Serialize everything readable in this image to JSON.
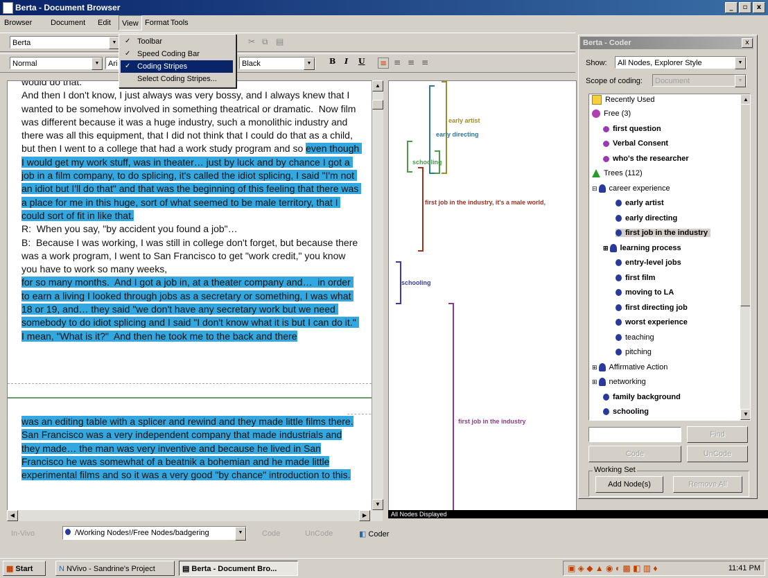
{
  "window": {
    "title": "Berta - Document Browser",
    "min": "_",
    "max": "▫",
    "close": "x"
  },
  "menubar": [
    "Browser",
    "Document",
    "Edit",
    "View",
    "Format",
    "Tools"
  ],
  "toolbar1": {
    "doc_name": "Berta"
  },
  "toolbar2": {
    "style": "Normal",
    "font": "Ari",
    "color": "Black",
    "bold": "B",
    "italic": "I",
    "underline": "U"
  },
  "view_menu": {
    "items": [
      {
        "label": "Toolbar",
        "checked": "✓"
      },
      {
        "label": "Speed Coding Bar",
        "checked": "✓"
      },
      {
        "label": "Coding Stripes",
        "checked": "✓"
      },
      {
        "label": "Select Coding Stripes...",
        "checked": ""
      }
    ]
  },
  "document": {
    "p1_plain": "would do that.\nAnd then I don't know, I just always was very bossy, and I always knew that I wanted to be somehow involved in something theatrical or dramatic.  Now film was different because it was a huge industry, such a monolithic industry and there was all this equipment, that I did not think that I could do that as a child, but then I went to a college that had a work study program and so",
    "p1_hl": "even though I would get my work stuff, was in theater… just by luck and by chance I got a job in a film company, to do splicing, it's called the idiot splicing, I said \"I'm not an idiot but I'll do that\" and that was the beginning of this feeling that there was a place for me in this huge, sort of what seemed to be male territory, that I could sort of fit in like that.",
    "p2_plain": "R:  When you say, \"by accident you found a job\"…\nB:  Because I was working, I was still in college don't forget, but because there was a work program, I went to San Francisco to get \"work credit,\" you know you have to work so many weeks,",
    "p2_hl": "for so many months.  And I got a job in, at a theater company and…  in order to earn a living I looked through jobs as a secretary or something, I was what 18 or 19, and… they said \"we don't have any secretary work but we need somebody to do idiot splicing and I said \"I don't know what it is but I can do it.\" I mean, \"What is it?\"  And then he took me to the back and there",
    "p3_hl": "was an editing table with a splicer and rewind and they made little films there.  San Francisco was a very independent company that made industrials and they made…  the man was very inventive and because he lived in San Francisco he was somewhat of a beatnik a bohemian and he made little experimental films and so it was a very good \"by chance\" introduction to this."
  },
  "stripes": {
    "early_artist": "early artist",
    "early_directing": "early directing",
    "schooling1": "schooling",
    "first_job_male": "first job in the industry, it's a male world,",
    "schooling2": "schooling",
    "first_job": "first job in the industry",
    "status": "All Nodes Displayed"
  },
  "colors": {
    "highlight": "#33a8e0",
    "artist": "#a08a2a",
    "directing": "#2a7a9a",
    "schooling": "#4a9a4a",
    "firstjob": "#a03020",
    "schooling2": "#3a3aa0",
    "firstjob2": "#8a3a8a"
  },
  "coder": {
    "title": "Berta - Coder",
    "close": "x",
    "show_label": "Show:",
    "show_value": "All Nodes, Explorer Style",
    "scope_label": "Scope of coding:",
    "scope_value": "Document",
    "tree": [
      {
        "label": "Recently Used",
        "icon": "folder-icon",
        "bold": false
      },
      {
        "label": "Free (3)",
        "icon": "free-node-icon",
        "bold": false
      },
      {
        "label": "first question",
        "icon": "node-icon",
        "bold": true
      },
      {
        "label": "Verbal Consent",
        "icon": "node-icon",
        "bold": true
      },
      {
        "label": "who's the researcher",
        "icon": "node-icon",
        "bold": true
      },
      {
        "label": "Trees (112)",
        "icon": "tree-icon",
        "bold": false
      },
      {
        "label": "career experience",
        "icon": "person-icon",
        "bold": false
      },
      {
        "label": "early artist",
        "icon": "node-icon",
        "bold": true
      },
      {
        "label": "early directing",
        "icon": "node-icon",
        "bold": true
      },
      {
        "label": "first job in the industry",
        "icon": "node-icon",
        "bold": true
      },
      {
        "label": "learning process",
        "icon": "person-icon",
        "bold": true
      },
      {
        "label": "entry-level jobs",
        "icon": "node-icon",
        "bold": true
      },
      {
        "label": "first film",
        "icon": "node-icon",
        "bold": true
      },
      {
        "label": "moving to LA",
        "icon": "node-icon",
        "bold": true
      },
      {
        "label": "first directing job",
        "icon": "node-icon",
        "bold": true
      },
      {
        "label": "worst experience",
        "icon": "node-icon",
        "bold": true
      },
      {
        "label": "teaching",
        "icon": "node-icon",
        "bold": false
      },
      {
        "label": "pitching",
        "icon": "node-icon",
        "bold": false
      },
      {
        "label": "Affirmative Action",
        "icon": "person-icon",
        "bold": false
      },
      {
        "label": "networking",
        "icon": "person-icon",
        "bold": false
      },
      {
        "label": "family background",
        "icon": "node-icon",
        "bold": true
      },
      {
        "label": "schooling",
        "icon": "node-icon",
        "bold": true
      }
    ],
    "find": "Find",
    "code": "Code",
    "uncode": "UnCode",
    "working_set": "Working Set",
    "add_nodes": "Add Node(s)",
    "remove_all": "Remove All"
  },
  "bottombar": {
    "invivo": "In-Vivo",
    "node_path": "/Working Nodes!/Free Nodes/badgering",
    "code": "Code",
    "uncode": "UnCode",
    "coder": "Coder"
  },
  "taskbar": {
    "start": "Start",
    "task1": "NVivo - Sandrine's Project",
    "task2": "Berta - Document Bro...",
    "time": "11:41 PM"
  }
}
